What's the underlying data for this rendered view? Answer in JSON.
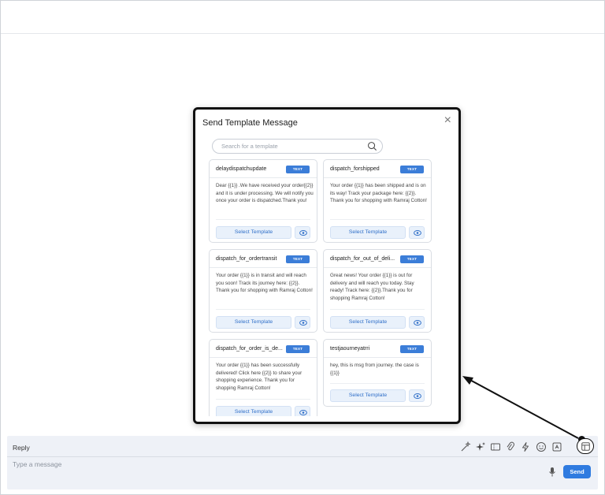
{
  "modal": {
    "title": "Send Template Message",
    "close_label": "×",
    "search_placeholder": "Search for a template",
    "select_label": "Select Template",
    "templates": [
      {
        "name": "delaydispatchupdate",
        "badge": "TEXT",
        "body": "Dear {{1}} .We have received your order{{2}} and it is under processing. We will notify you once your order is dispatched.Thank you!"
      },
      {
        "name": "dispatch_forshipped",
        "badge": "TEXT",
        "body": "Your order {{1}} has been shipped and is on its way! Track your package here: {{2}}. Thank you for shopping with Ramraj Cotton!"
      },
      {
        "name": "dispatch_for_ordertransit",
        "badge": "TEXT",
        "body": "Your order {{1}} is in transit and will reach you soon! Track its journey here: {{2}}. Thank you for shopping with Ramraj Cotton!"
      },
      {
        "name": "dispatch_for_out_of_deli...",
        "badge": "TEXT",
        "body": "Great news! Your order {{1}} is out for delivery and will reach you today. Stay ready! Track here: {{2}}.Thank you for shopping Ramraj Cotton!"
      },
      {
        "name": "dispatch_for_order_is_de...",
        "badge": "TEXT",
        "body": "Your order {{1}} has been successfully delivered! Click here {{2}} to share your shopping experience. Thank you for shopping Ramraj Cotton!"
      },
      {
        "name": "testjaourneyatrri",
        "badge": "TEXT",
        "body": "hey, this is msg from journey. the case is {{1}}"
      }
    ]
  },
  "reply": {
    "label": "Reply",
    "placeholder": "Type a message",
    "send_label": "Send",
    "toolbar_icons": [
      "magic-wand-icon",
      "sparkle-icon",
      "ticket-icon",
      "paperclip-icon",
      "lightning-icon",
      "emoji-icon",
      "file-icon",
      "template-icon"
    ]
  },
  "colors": {
    "accent": "#2f7be0",
    "badge": "#3b7dd8",
    "panel_bg": "#eef1f7"
  }
}
